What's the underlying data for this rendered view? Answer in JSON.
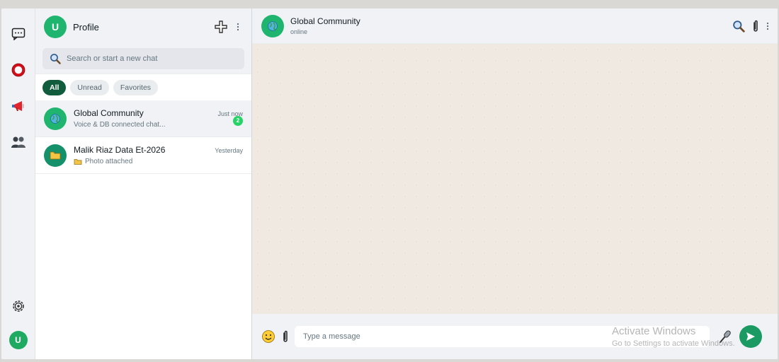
{
  "rail": {
    "user_initial": "U",
    "icons": [
      "chats-icon",
      "status-icon",
      "channels-icon",
      "communities-icon",
      "settings-icon"
    ]
  },
  "sidebar": {
    "avatar_initial": "U",
    "title": "Profile",
    "search_placeholder": "Search or start a new chat",
    "filters": [
      "All",
      "Unread",
      "Favorites"
    ],
    "active_filter": "All",
    "chats": [
      {
        "name": "Global Community",
        "preview": "Voice & DB connected chat...",
        "time": "Just now",
        "unread": "2",
        "icon": "globe-icon",
        "avatar_color": "#1fb56e"
      },
      {
        "name": "Malik Riaz Data Et-2026",
        "preview": "Photo attached",
        "time": "Yesterday",
        "unread": "",
        "icon": "folder-icon",
        "avatar_color": "#14906a"
      }
    ]
  },
  "main": {
    "title": "Global Community",
    "status": "online",
    "message_placeholder": "Type a message"
  },
  "watermark": {
    "line1": "Activate Windows",
    "line2": "Go to Settings to activate Windows."
  },
  "colors": {
    "accent": "#1fb56e",
    "active_chip": "#125c3e",
    "badge": "#25d366",
    "send": "#1b9a63"
  }
}
